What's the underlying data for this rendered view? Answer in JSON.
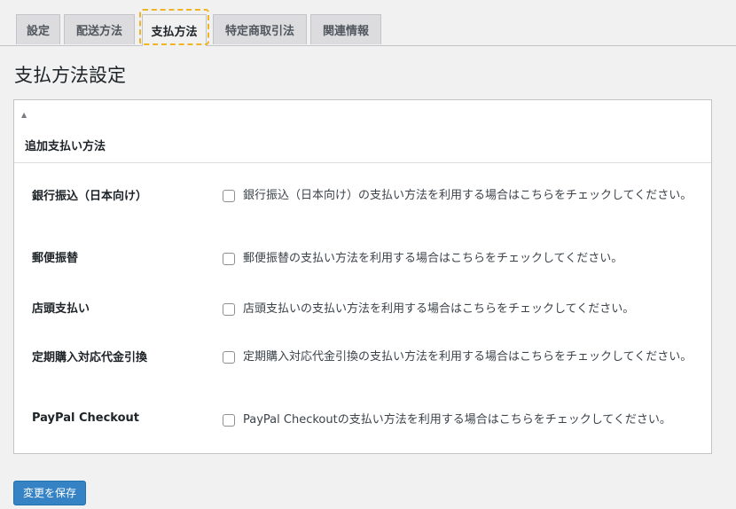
{
  "tabs": [
    {
      "label": "設定"
    },
    {
      "label": "配送方法"
    },
    {
      "label": "支払方法",
      "active": true
    },
    {
      "label": "特定商取引法"
    },
    {
      "label": "関連情報"
    }
  ],
  "page_title": "支払方法設定",
  "panel": {
    "toggle_glyph": "▲",
    "title": "追加支払い方法"
  },
  "methods": [
    {
      "label": "銀行振込（日本向け）",
      "description": "銀行振込（日本向け）の支払い方法を利用する場合はこちらをチェックしてください。",
      "checked": false
    },
    {
      "label": "郵便振替",
      "description": "郵便振替の支払い方法を利用する場合はこちらをチェックしてください。",
      "checked": false
    },
    {
      "label": "店頭支払い",
      "description": "店頭支払いの支払い方法を利用する場合はこちらをチェックしてください。",
      "checked": false
    },
    {
      "label": "定期購入対応代金引換",
      "description": "定期購入対応代金引換の支払い方法を利用する場合はこちらをチェックしてください。",
      "checked": false
    },
    {
      "label": "PayPal Checkout",
      "description": "PayPal Checkoutの支払い方法を利用する場合はこちらをチェックしてください。",
      "checked": false
    }
  ],
  "save_button": {
    "label": "変更を保存"
  },
  "colors": {
    "primary": "#2271b1",
    "highlight": "#f0b323",
    "background": "#f1f1f1"
  }
}
